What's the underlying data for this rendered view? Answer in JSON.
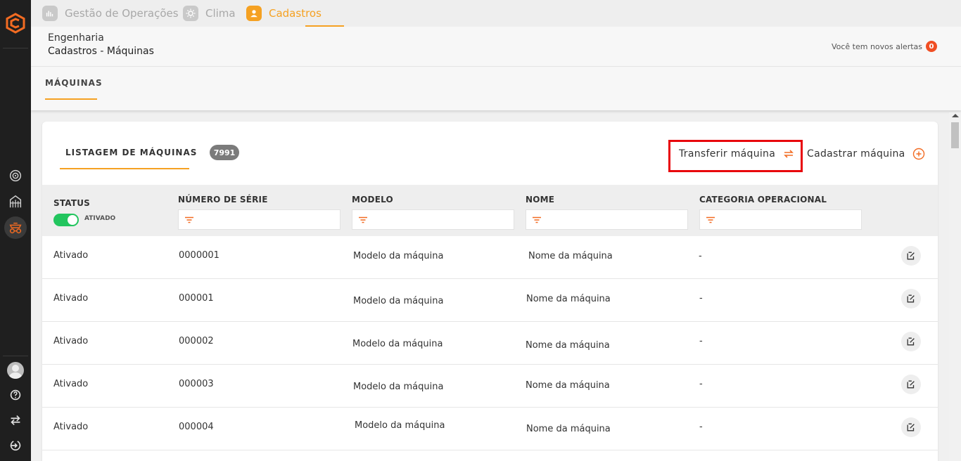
{
  "topnav": {
    "tabs": [
      {
        "label": "Gestão de Operações",
        "icon": "chart-hand-icon"
      },
      {
        "label": "Clima",
        "icon": "sun-icon"
      },
      {
        "label": "Cadastros",
        "icon": "user-icon",
        "active": true
      }
    ]
  },
  "header": {
    "breadcrumb_parent": "Engenharia",
    "breadcrumb_title": "Cadastros - Máquinas",
    "alerts_label": "Você tem novos alertas",
    "alerts_count": "0"
  },
  "section": {
    "tab_label": "MÁQUINAS"
  },
  "card": {
    "tab_label": "LISTAGEM DE MÁQUINAS",
    "count": "7991",
    "transfer_label": "Transferir máquina",
    "register_label": "Cadastrar máquina"
  },
  "table": {
    "headers": {
      "status": "STATUS",
      "serial": "NÚMERO DE SÉRIE",
      "model": "MODELO",
      "name": "NOME",
      "category": "CATEGORIA OPERACIONAL"
    },
    "status_toggle_label": "ATIVADO",
    "rows": [
      {
        "status": "Ativado",
        "serial": "0000001",
        "model": "Modelo da máquina",
        "name": "Nome da máquina",
        "category": "-"
      },
      {
        "status": "Ativado",
        "serial": "000001",
        "model": "Modelo da máquina",
        "name": "Nome da máquina",
        "category": "-"
      },
      {
        "status": "Ativado",
        "serial": "000002",
        "model": "Modelo da máquina",
        "name": "Nome da máquina",
        "category": "-"
      },
      {
        "status": "Ativado",
        "serial": "000003",
        "model": "Modelo da máquina",
        "name": "Nome da máquina",
        "category": "-"
      },
      {
        "status": "Ativado",
        "serial": "000004",
        "model": "Modelo da máquina",
        "name": "Nome da máquina",
        "category": "-"
      }
    ]
  },
  "colors": {
    "accent": "#f5a122",
    "sidebar": "#1f1f1f",
    "highlight": "#e8060c",
    "toggle_on": "#22c55e",
    "alert_badge": "#f04e23"
  }
}
